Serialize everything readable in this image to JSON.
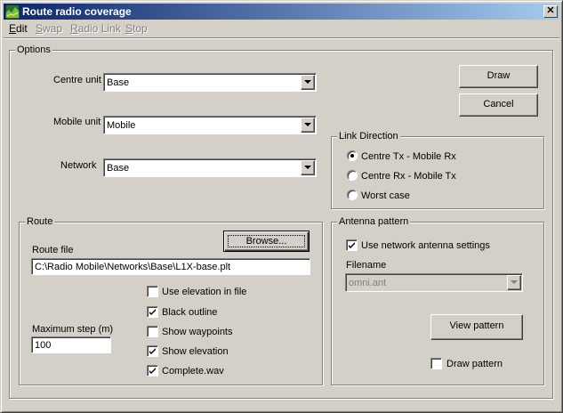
{
  "window": {
    "title": "Route radio coverage",
    "close_glyph": "✕"
  },
  "menu": [
    {
      "label": "Edit",
      "enabled": true
    },
    {
      "label": "Swap",
      "enabled": false
    },
    {
      "label": "Radio Link",
      "enabled": false
    },
    {
      "label": "Stop",
      "enabled": false
    }
  ],
  "options": {
    "title": "Options",
    "centre_unit": {
      "label": "Centre unit",
      "value": "Base"
    },
    "mobile_unit": {
      "label": "Mobile unit",
      "value": "Mobile"
    },
    "network": {
      "label": "Network",
      "value": "Base"
    }
  },
  "buttons": {
    "draw": "Draw",
    "cancel": "Cancel",
    "browse": "Browse...",
    "view_pattern": "View pattern"
  },
  "link_direction": {
    "title": "Link Direction",
    "options": [
      {
        "label": "Centre Tx - Mobile Rx",
        "checked": true
      },
      {
        "label": "Centre Rx - Mobile Tx",
        "checked": false
      },
      {
        "label": "Worst case",
        "checked": false
      }
    ]
  },
  "route": {
    "title": "Route",
    "file_label": "Route file",
    "file_value": "C:\\Radio Mobile\\Networks\\Base\\L1X-base.plt",
    "max_step_label": "Maximum step (m)",
    "max_step_value": "100",
    "checkboxes": [
      {
        "label": "Use elevation in file",
        "checked": false
      },
      {
        "label": "Black outline",
        "checked": true
      },
      {
        "label": "Show waypoints",
        "checked": false
      },
      {
        "label": "Show elevation",
        "checked": true
      },
      {
        "label": "Complete.wav",
        "checked": true
      }
    ]
  },
  "antenna_pattern": {
    "title": "Antenna pattern",
    "use_network": {
      "label": "Use network antenna settings",
      "checked": true
    },
    "filename_label": "Filename",
    "filename_value": "omni.ant",
    "draw_pattern": {
      "label": "Draw pattern",
      "checked": false
    }
  },
  "colors": {
    "titlebar_start": "#0a246a",
    "titlebar_end": "#a6caf0",
    "face": "#d4d0c8"
  }
}
